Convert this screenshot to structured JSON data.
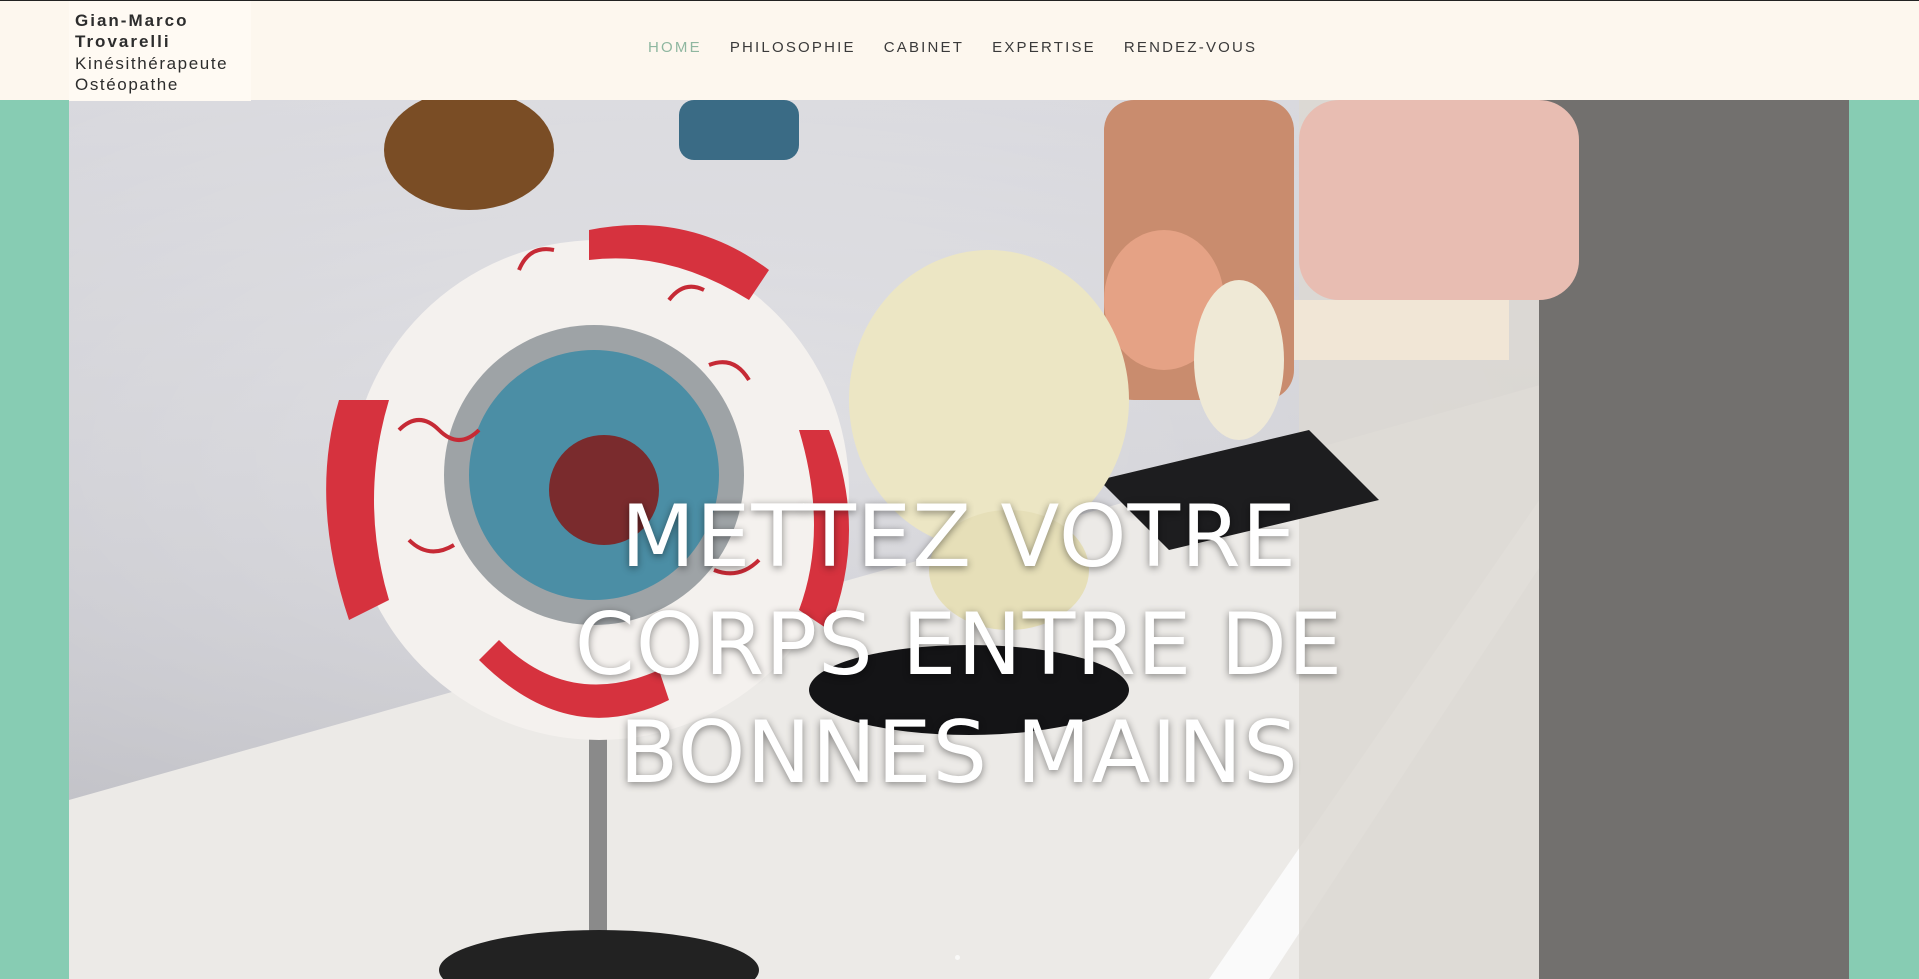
{
  "brand": {
    "name_line1": "Gian-Marco",
    "name_line2": "Trovarelli",
    "title_line1": "Kinésithérapeute",
    "title_line2": "Ostéopathe"
  },
  "nav": {
    "items": [
      {
        "label": "HOME",
        "active": true
      },
      {
        "label": "PHILOSOPHIE",
        "active": false
      },
      {
        "label": "CABINET",
        "active": false
      },
      {
        "label": "EXPERTISE",
        "active": false
      },
      {
        "label": "RENDEZ-VOUS",
        "active": false
      }
    ]
  },
  "hero": {
    "line1": "METTEZ VOTRE",
    "line2": "CORPS ENTRE DE",
    "line3": "BONNES MAINS"
  },
  "colors": {
    "page_bg": "#87ccb3",
    "header_bg": "#fdf7ee",
    "nav_active": "#8fb7a0",
    "nav_text": "#3a3a3a",
    "hero_text": "#ffffff"
  }
}
